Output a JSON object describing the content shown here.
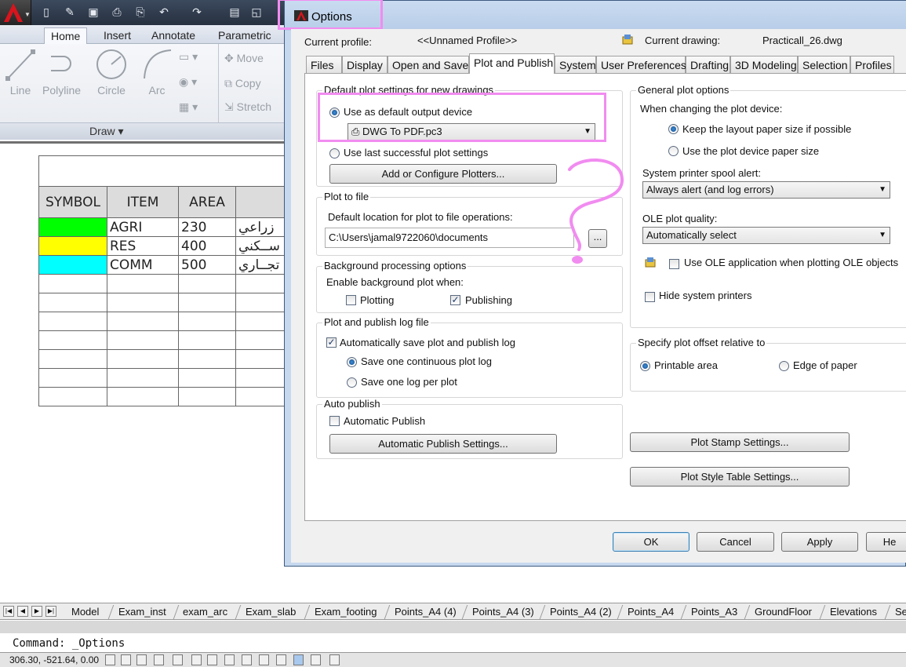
{
  "ribbon": {
    "tabs": [
      "Home",
      "Insert",
      "Annotate",
      "Parametric"
    ],
    "draw_tools": [
      "Line",
      "Polyline",
      "Circle",
      "Arc"
    ],
    "modify_tools": [
      "Move",
      "Copy",
      "Stretch"
    ],
    "panel_label": "Draw"
  },
  "drawing_table": {
    "headers": [
      "SYMBOL",
      "ITEM",
      "AREA",
      ""
    ],
    "rows": [
      {
        "color": "#00ff00",
        "item": "AGRI",
        "area": "230",
        "arabic": "زراعي"
      },
      {
        "color": "#ffff00",
        "item": "RES",
        "area": "400",
        "arabic": "ســكني"
      },
      {
        "color": "#00ffff",
        "item": "COMM",
        "area": "500",
        "arabic": "تجــاري"
      }
    ]
  },
  "layout_tabs": [
    "Model",
    "Exam_inst",
    "exam_arc",
    "Exam_slab",
    "Exam_footing",
    "Points_A4 (4)",
    "Points_A4 (3)",
    "Points_A4 (2)",
    "Points_A4",
    "Points_A3",
    "GroundFloor",
    "Elevations",
    "Se"
  ],
  "command_line": "Command:  _Options",
  "status": {
    "coords": "306.30, -521.64, 0.00"
  },
  "dialog": {
    "title": "Options",
    "current_profile_label": "Current profile:",
    "current_profile_value": "<<Unnamed Profile>>",
    "current_drawing_label": "Current drawing:",
    "current_drawing_value": "Practicall_26.dwg",
    "tabs": [
      "Files",
      "Display",
      "Open and Save",
      "Plot and Publish",
      "System",
      "User Preferences",
      "Drafting",
      "3D Modeling",
      "Selection",
      "Profiles"
    ],
    "active_tab": "Plot and Publish",
    "default_plot": {
      "group_label": "Default plot settings for new drawings",
      "use_default_device": "Use as default output device",
      "device": "DWG To PDF.pc3",
      "use_last": "Use last successful plot settings",
      "add_plotters": "Add or Configure Plotters..."
    },
    "plot_to_file": {
      "group_label": "Plot to file",
      "location_label": "Default location for plot to file operations:",
      "location_value": "C:\\Users\\jamal9722060\\documents",
      "browse": "..."
    },
    "background": {
      "group_label": "Background processing options",
      "enable_label": "Enable background plot when:",
      "plotting": "Plotting",
      "publishing": "Publishing"
    },
    "log": {
      "group_label": "Plot and publish log file",
      "auto_save": "Automatically save plot and publish log",
      "continuous": "Save one continuous plot log",
      "per_plot": "Save one log per plot"
    },
    "auto_publish": {
      "group_label": "Auto publish",
      "automatic": "Automatic Publish",
      "settings": "Automatic Publish Settings..."
    },
    "general": {
      "group_label": "General plot options",
      "changing_label": "When changing the plot device:",
      "keep_layout": "Keep the layout paper size if possible",
      "use_device": "Use the plot device paper size",
      "spool_label": "System printer spool alert:",
      "spool_value": "Always alert (and log errors)",
      "ole_label": "OLE plot quality:",
      "ole_value": "Automatically select",
      "use_ole": "Use OLE application when plotting OLE objects",
      "hide_printers": "Hide system printers"
    },
    "offset": {
      "group_label": "Specify plot offset relative to",
      "printable": "Printable area",
      "edge": "Edge of paper"
    },
    "plot_stamp": "Plot Stamp Settings...",
    "plot_style": "Plot Style Table Settings...",
    "buttons": {
      "ok": "OK",
      "cancel": "Cancel",
      "apply": "Apply",
      "help": "He"
    }
  },
  "colors": {
    "annotation": "#f18cf0",
    "dialog_border": "#3d5b80"
  }
}
